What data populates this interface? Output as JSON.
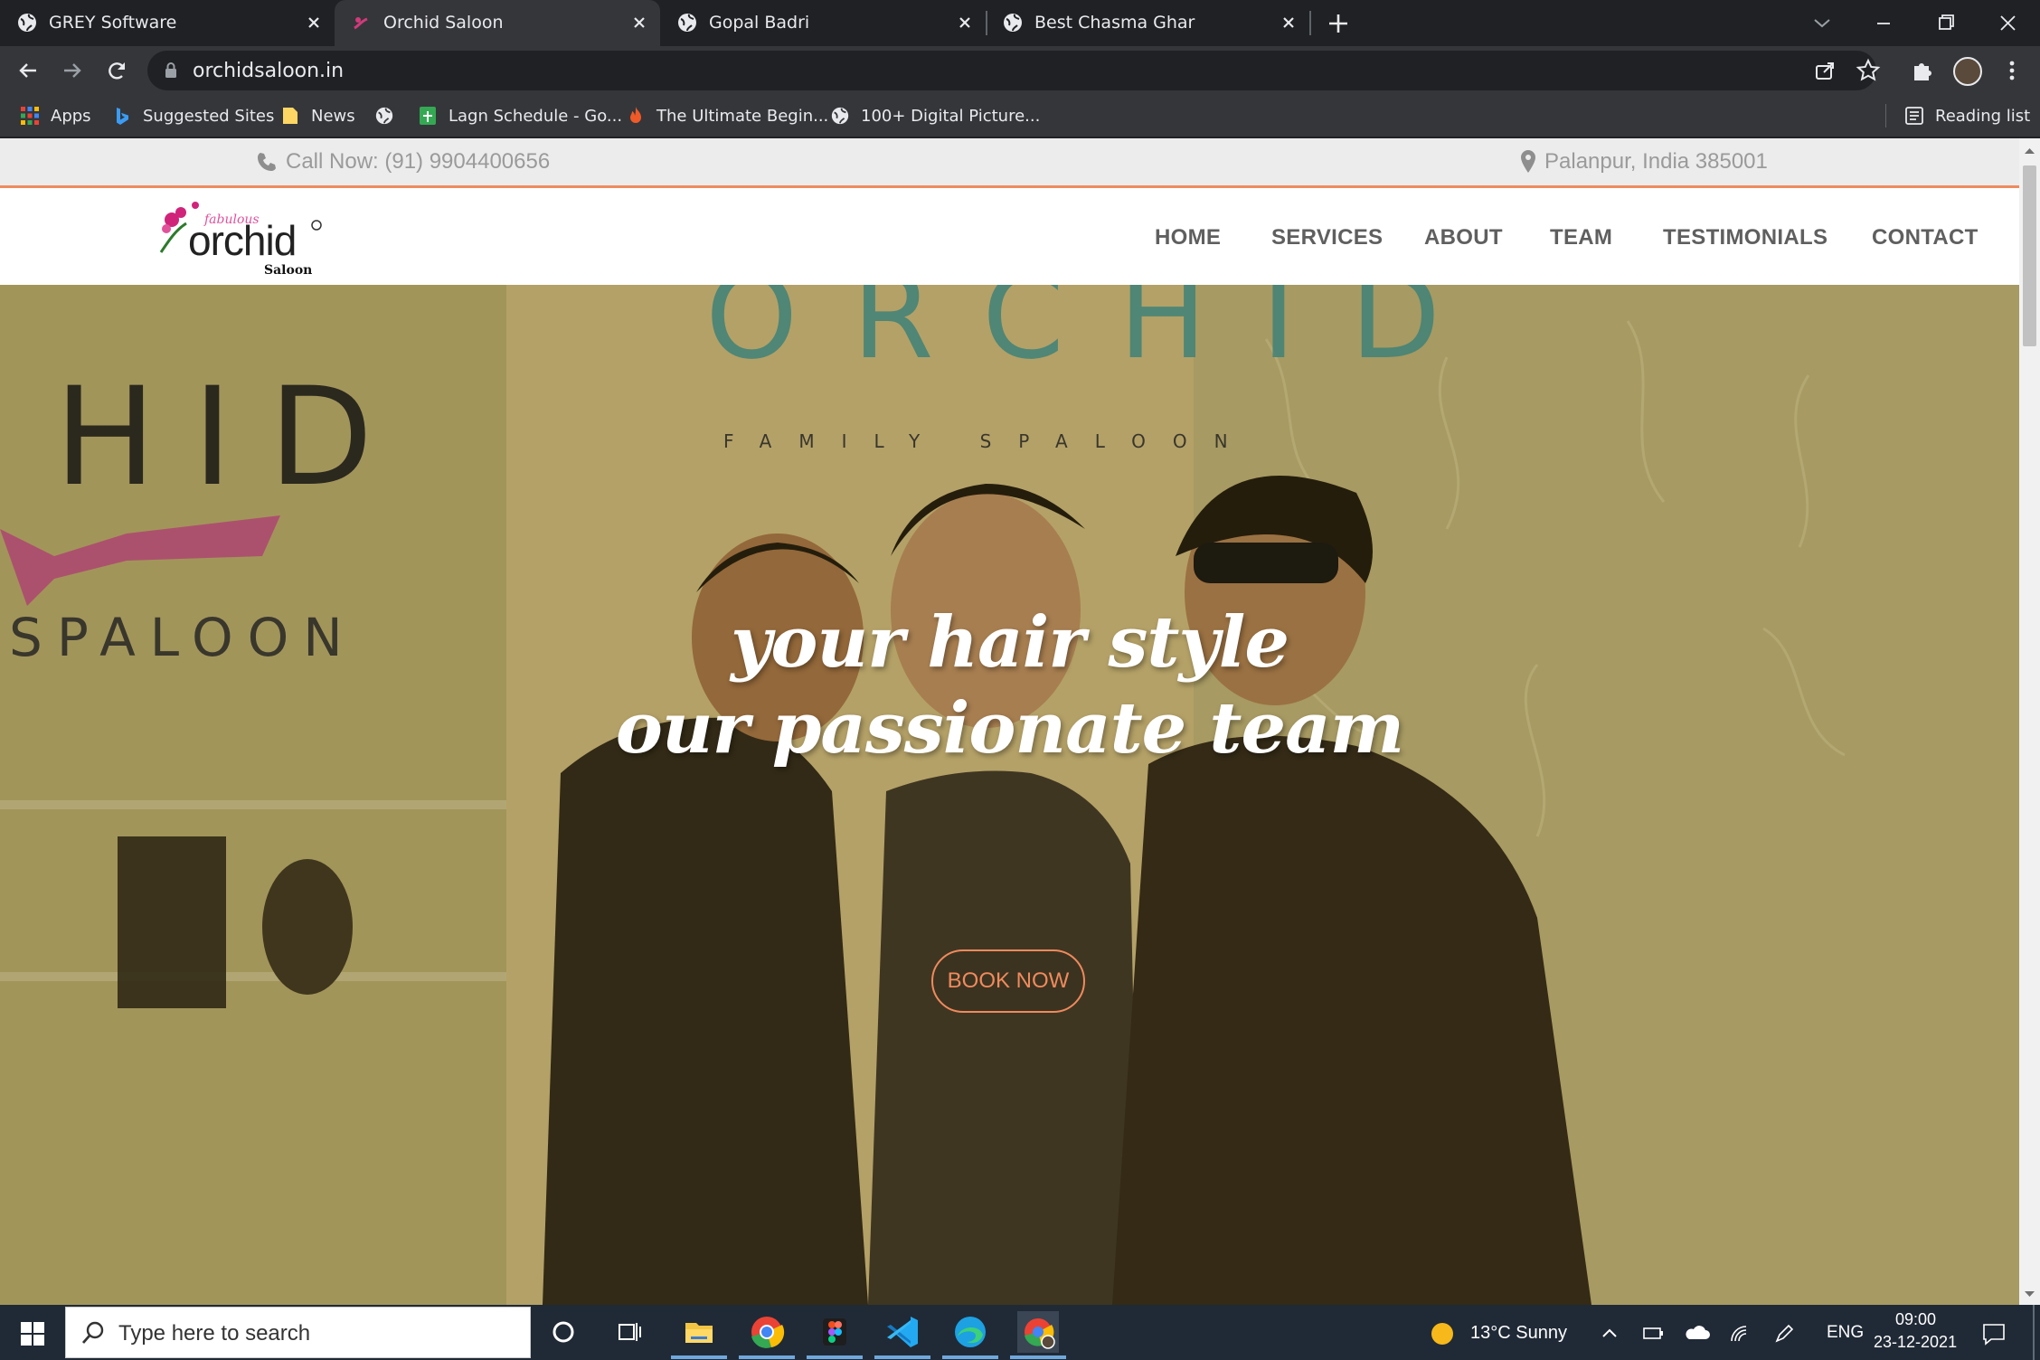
{
  "browser": {
    "tabs": [
      {
        "title": "GREY Software",
        "active": false
      },
      {
        "title": "Orchid Saloon",
        "active": true
      },
      {
        "title": "Gopal Badri",
        "active": false
      },
      {
        "title": "Best Chasma Ghar",
        "active": false
      }
    ],
    "url": "orchidsaloon.in",
    "bookmarks": [
      "Apps",
      "Suggested Sites",
      "News",
      "Lagn Schedule - Go...",
      "The Ultimate Begin...",
      "100+ Digital Picture..."
    ],
    "reading_list": "Reading list"
  },
  "site": {
    "topbar": {
      "call": "Call Now: (91) 9904400656",
      "location": "Palanpur, India 385001"
    },
    "logo": {
      "top": "fabulous",
      "main": "orchid",
      "sub": "Saloon"
    },
    "nav": [
      "HOME",
      "SERVICES",
      "ABOUT",
      "TEAM",
      "TESTIMONIALS",
      "CONTACT"
    ],
    "hero": {
      "line1": "your hair style",
      "line2": "our passionate team",
      "cta": "BOOK NOW",
      "background_words": [
        "HID",
        "SPALOON",
        "ORCHID",
        "FAMILY SPALOON"
      ]
    },
    "colors": {
      "accent": "#f08a5d",
      "chat": "#0f8a9e"
    }
  },
  "taskbar": {
    "search_placeholder": "Type here to search",
    "weather": "13°C  Sunny",
    "lang": "ENG",
    "time": "09:00",
    "date": "23-12-2021"
  }
}
